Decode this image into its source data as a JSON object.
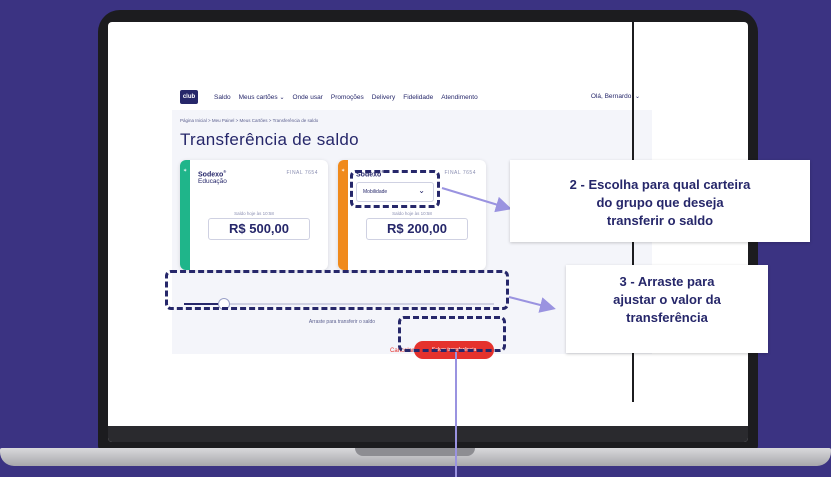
{
  "app": {
    "logo_text": "club",
    "nav": [
      "Saldo",
      "Meus cartões",
      "Onde usar",
      "Promoções",
      "Delivery",
      "Fidelidade",
      "Atendimento"
    ],
    "greeting": "Olá, Bernardo!",
    "breadcrumb": "Página Inicial > Meu Painel > Meus Cartões > Transferência de saldo",
    "page_title": "Transferência de saldo",
    "card_left": {
      "brand": "Sodexo",
      "subtitle": "Educação",
      "final": "FINAL 7654",
      "balance_time": "Saldo hoje às 10:58",
      "amount": "R$ 500,00",
      "stripe_color": "#1fb58a"
    },
    "card_right": {
      "brand": "Sodexo",
      "final": "FINAL 7654",
      "select_value": "Mobilidade",
      "balance_time": "Saldo hoje às 10:58",
      "amount": "R$ 200,00",
      "stripe_color": "#f08a1c"
    },
    "slider": {
      "hint": "Arraste para transferir o saldo",
      "value_fraction": 0.13
    },
    "cancel_label": "Cancelar",
    "submit_label": "Salvar transferência"
  },
  "callouts": {
    "step2": [
      "2 - Escolha para qual carteira",
      "do grupo que deseja",
      "transferir o saldo"
    ],
    "step3": [
      "3 - Arraste para",
      "ajustar o valor da",
      "transferência"
    ]
  },
  "colors": {
    "background": "#3b3382",
    "primary": "#26276a",
    "accent_red": "#e5322d",
    "arrow": "#9a93e0"
  },
  "icons": [
    "star-icon",
    "chevron-down-icon",
    "arrow-icon"
  ]
}
